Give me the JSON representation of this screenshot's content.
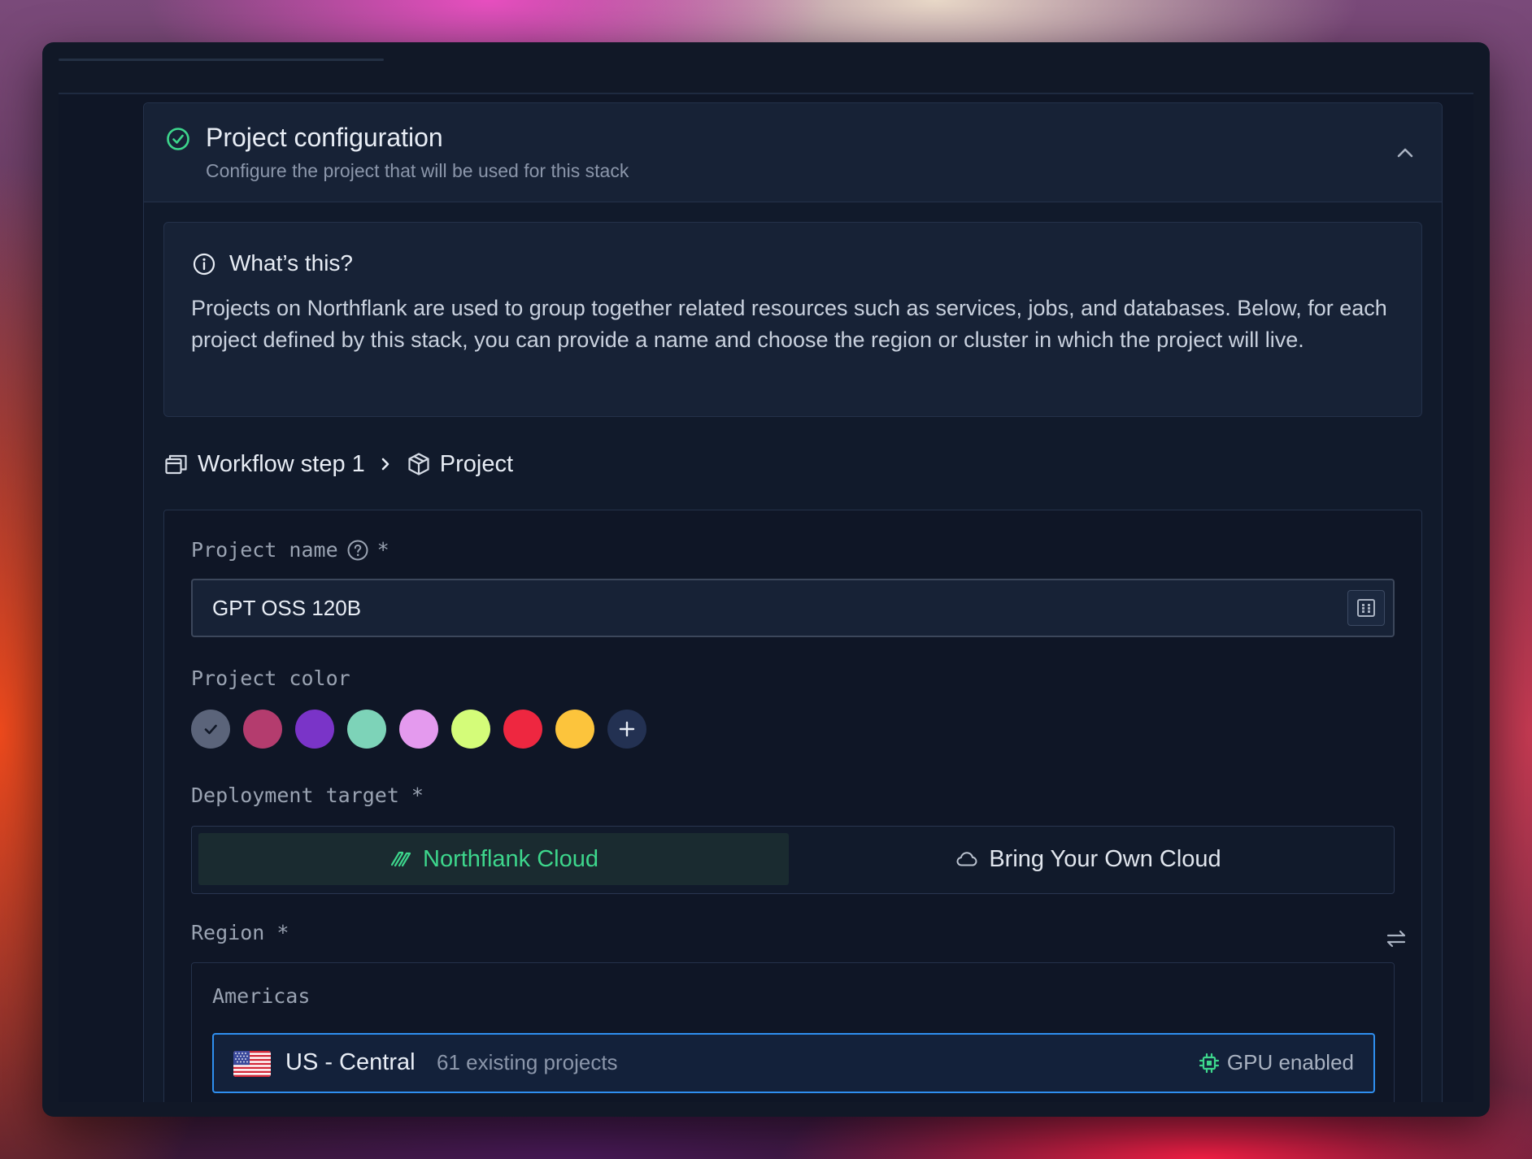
{
  "section": {
    "title": "Project configuration",
    "subtitle": "Configure the project that will be used for this stack"
  },
  "info": {
    "title": "What’s this?",
    "text": "Projects on Northflank are used to group together related resources such as services, jobs, and databases. Below, for each project defined by this stack, you can provide a name and choose the region or cluster in which the project will live."
  },
  "breadcrumb": {
    "step": "Workflow step 1",
    "item": "Project"
  },
  "form": {
    "project_name_label": "Project name",
    "required_mark": "*",
    "project_name_value": "GPT OSS 120B",
    "project_color_label": "Project color",
    "colors": [
      "#5b647a",
      "#b43c6e",
      "#7a34c8",
      "#7dd3b8",
      "#e49aee",
      "#d4fc79",
      "#ee2740",
      "#fcc43c"
    ],
    "selected_color_index": 0,
    "deployment_target_label": "Deployment target *",
    "targets": {
      "northflank": "Northflank Cloud",
      "byoc": "Bring Your Own Cloud",
      "selected": "northflank"
    },
    "region_label": "Region *",
    "region_group": "Americas",
    "regions": [
      {
        "name": "US - Central",
        "projects": "61 existing projects",
        "badge": "GPU enabled",
        "selected": true
      }
    ]
  },
  "colors": {
    "accent_green": "#3dd68c",
    "accent_blue": "#2f8ff0",
    "window_bg": "#111827"
  },
  "icons": [
    "check-circle-icon",
    "chevron-up-icon",
    "info-icon",
    "window-stack-icon",
    "chevron-right-icon",
    "cube-icon",
    "help-circle-icon",
    "template-icon",
    "checkmark-icon",
    "plus-icon",
    "northflank-logo-icon",
    "cloud-icon",
    "swap-icon",
    "us-flag-icon",
    "chip-icon"
  ]
}
